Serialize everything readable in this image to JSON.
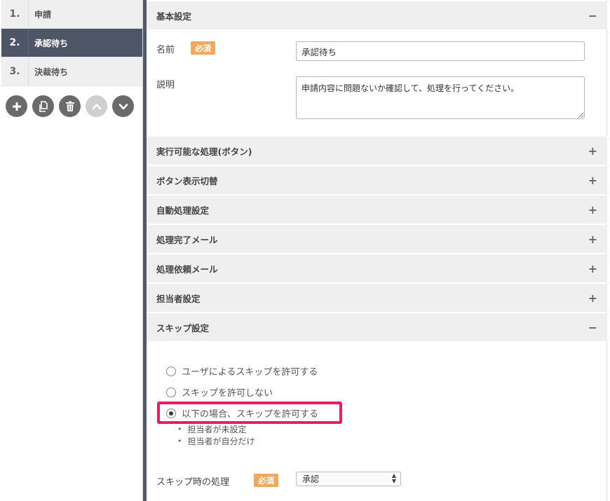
{
  "steps": [
    {
      "num": "1.",
      "label": "申請",
      "active": false
    },
    {
      "num": "2.",
      "label": "承認待ち",
      "active": true
    },
    {
      "num": "3.",
      "label": "決裁待ち",
      "active": false
    }
  ],
  "tools": [
    {
      "icon": "plus-icon"
    },
    {
      "icon": "copy-icon"
    },
    {
      "icon": "trash-icon"
    },
    {
      "icon": "chevron-up-icon",
      "disabled": true
    },
    {
      "icon": "chevron-down-icon"
    }
  ],
  "basic": {
    "title": "基本設定",
    "toggle": "−",
    "name_label": "名前",
    "required": "必須",
    "name_value": "承認待ち",
    "desc_label": "説明",
    "desc_value": "申請内容に問題ないか確認して、処理を行ってください。"
  },
  "sections": [
    {
      "title": "実行可能な処理(ボタン)",
      "toggle": "+"
    },
    {
      "title": "ボタン表示切替",
      "toggle": "+"
    },
    {
      "title": "自動処理設定",
      "toggle": "+"
    },
    {
      "title": "処理完了メール",
      "toggle": "+"
    },
    {
      "title": "処理依頼メール",
      "toggle": "+"
    },
    {
      "title": "担当者設定",
      "toggle": "+"
    }
  ],
  "skip": {
    "title": "スキップ設定",
    "toggle": "−",
    "options": [
      {
        "label": "ユーザによるスキップを許可する",
        "checked": false
      },
      {
        "label": "スキップを許可しない",
        "checked": false
      },
      {
        "label": "以下の場合、スキップを許可する",
        "checked": true
      }
    ],
    "conditions": [
      "担当者が未設定",
      "担当者が自分だけ"
    ],
    "action_label": "スキップ時の処理",
    "required": "必須",
    "action_value": "承認"
  },
  "colors": {
    "active_step": "#4d5566",
    "required_badge": "#f0a95c",
    "highlight": "#ea1f63",
    "section_header": "#efefef"
  }
}
